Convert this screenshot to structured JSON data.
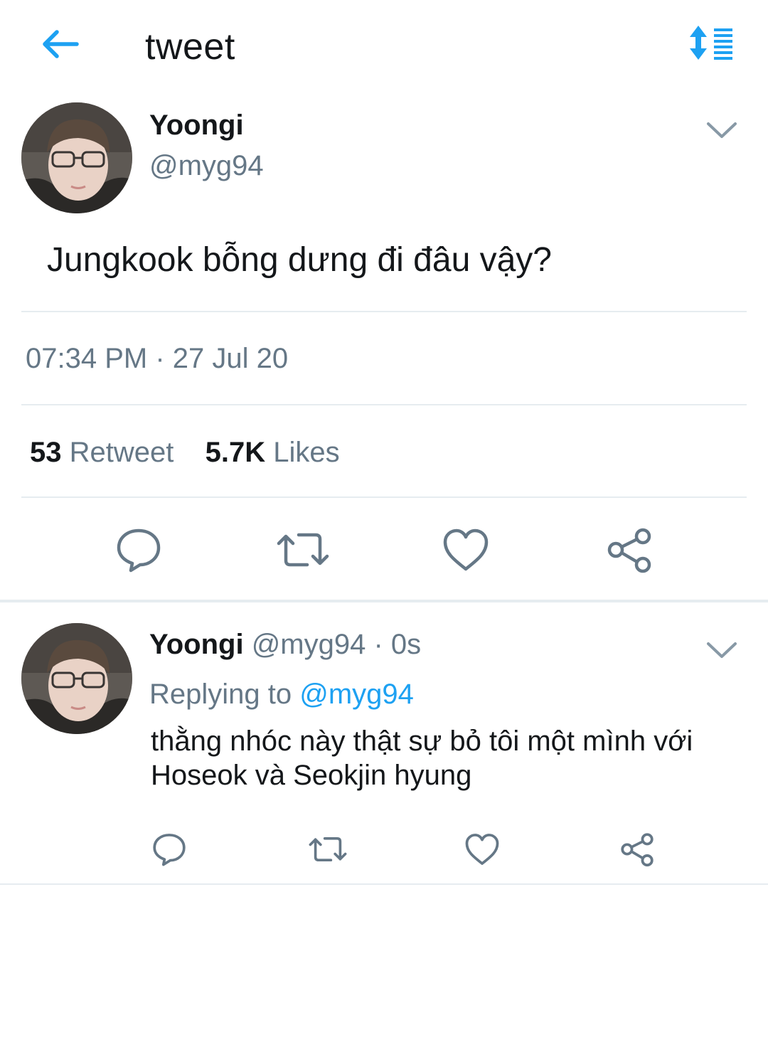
{
  "header": {
    "title": "tweet",
    "back_icon": "arrow-left-icon",
    "sort_icon": "sort-list-icon",
    "accent_color": "#1da1f2"
  },
  "tweet": {
    "author_name": "Yoongi",
    "author_handle": "@myg94",
    "text": "Jungkook bỗng dưng đi đâu vậy?",
    "timestamp": "07:34 PM · 27 Jul 20",
    "retweet_count": "53",
    "retweet_label": "Retweet",
    "likes_count": "5.7K",
    "likes_label": "Likes",
    "actions": [
      "reply-icon",
      "retweet-icon",
      "heart-icon",
      "share-icon"
    ]
  },
  "reply": {
    "author_name": "Yoongi",
    "meta": "@myg94 · 0s",
    "replying_prefix": "Replying to",
    "replying_handle": "@myg94",
    "text_lines": [
      "thằng nhóc này thật sự bỏ tôi một mình với",
      "Hoseok và Seokjin hyung"
    ],
    "actions": [
      "reply-icon",
      "retweet-icon",
      "heart-icon",
      "share-icon"
    ]
  },
  "colors": {
    "text_primary": "#14171a",
    "text_secondary": "#657786",
    "link": "#1da1f2",
    "divider": "#e6ecf0"
  }
}
